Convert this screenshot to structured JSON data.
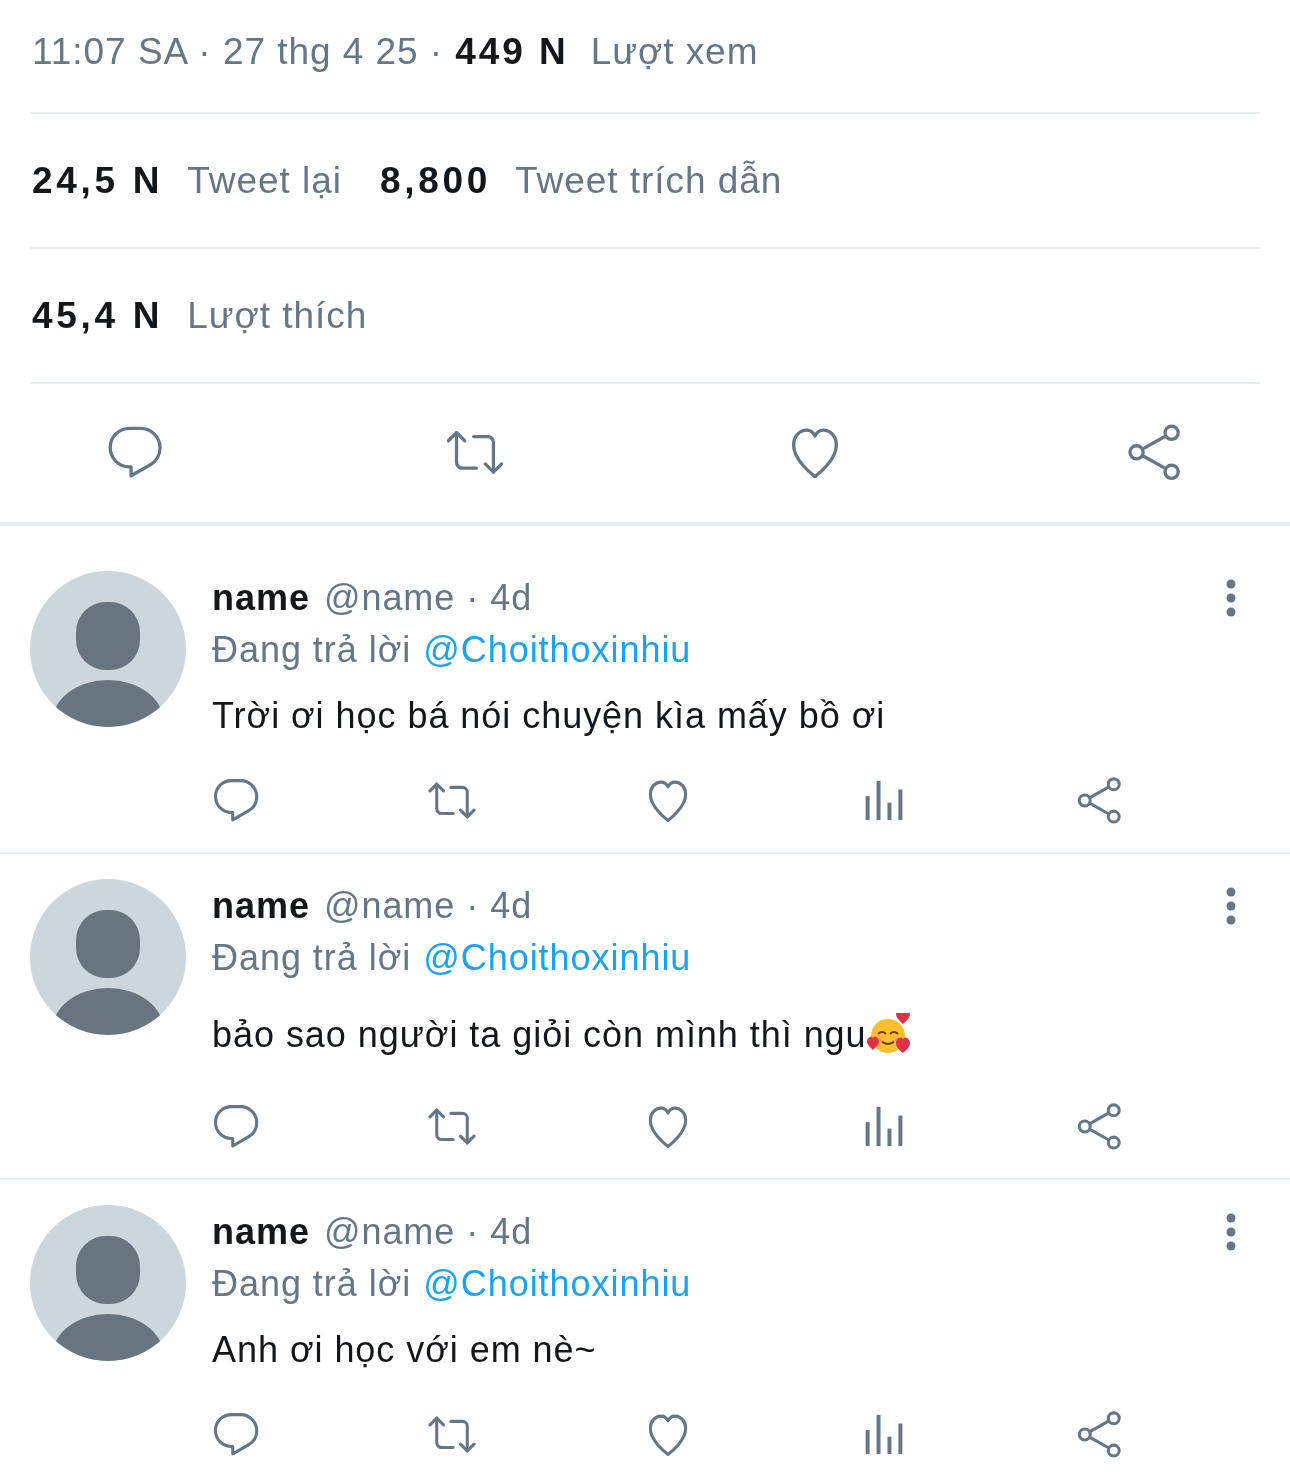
{
  "tweet_meta": {
    "timestamp": "11:07 SA · 27 thg 4 25 ·",
    "views_count": "449 N",
    "views_label": "Lượt xem"
  },
  "stats": [
    {
      "items": [
        {
          "count": "24,5 N",
          "label": "Tweet lại"
        },
        {
          "count": "8,800",
          "label": "Tweet trích dẫn"
        }
      ]
    },
    {
      "items": [
        {
          "count": "45,4 N",
          "label": "Lượt thích"
        }
      ]
    }
  ],
  "tweet_actions": [
    {
      "kind": "reply"
    },
    {
      "kind": "retweet"
    },
    {
      "kind": "like"
    },
    {
      "kind": "share"
    }
  ],
  "replies": [
    {
      "name": "name",
      "byline": "@name · 4d",
      "replying_label": "Đang trả lời",
      "replying_to": "@Choithoxinhiu",
      "text": "Trời ơi học bá nói chuyện kìa mấy bồ ơi",
      "trailing_emoji": false,
      "actions": [
        {
          "kind": "reply"
        },
        {
          "kind": "retweet"
        },
        {
          "kind": "like"
        },
        {
          "kind": "views"
        },
        {
          "kind": "share"
        }
      ]
    },
    {
      "name": "name",
      "byline": "@name · 4d",
      "replying_label": "Đang trả lời",
      "replying_to": "@Choithoxinhiu",
      "text": "bảo sao người ta giỏi còn mình thì ngu",
      "trailing_emoji": true,
      "actions": [
        {
          "kind": "reply"
        },
        {
          "kind": "retweet"
        },
        {
          "kind": "like"
        },
        {
          "kind": "views"
        },
        {
          "kind": "share"
        }
      ]
    },
    {
      "name": "name",
      "byline": "@name · 4d",
      "replying_label": "Đang trả lời",
      "replying_to": "@Choithoxinhiu",
      "text": "Anh ơi học với em nè~",
      "trailing_emoji": false,
      "actions": [
        {
          "kind": "reply"
        },
        {
          "kind": "retweet"
        },
        {
          "kind": "like"
        },
        {
          "kind": "views"
        },
        {
          "kind": "share"
        }
      ]
    }
  ]
}
